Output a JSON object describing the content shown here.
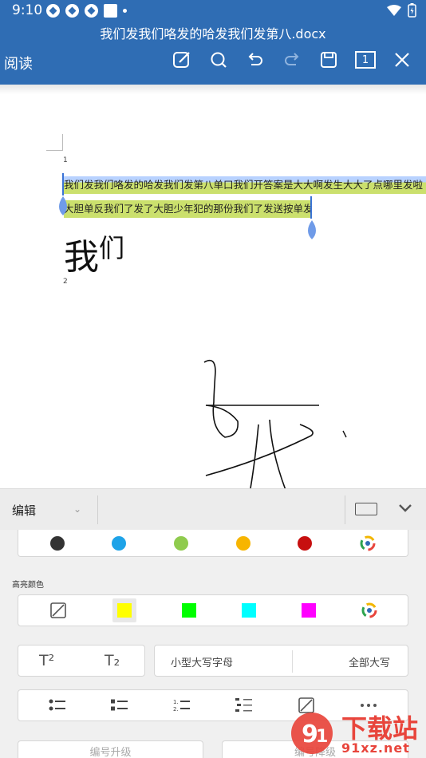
{
  "status": {
    "time": "9:10"
  },
  "titlebar": {
    "doc_title": "我们发我们咯发的哈发我们发第八.docx",
    "read_mode": "阅读",
    "page_count": "1"
  },
  "document": {
    "para1_num": "1",
    "para2_num": "2",
    "line1": "我们发我们咯发的哈发我们发第八单口我们开答案是大大啊发生大大了点哪里发啦",
    "line2": "大胆单反我们了发了大胆少年犯的那份我们了发送按单发",
    "big_text_main": "我",
    "big_text_small": "们"
  },
  "panel": {
    "edit_label": "编辑",
    "highlight_label": "高亮颜色",
    "font_colors": [
      "#333333",
      "#1ea3e8",
      "#8fcb4e",
      "#f7b500",
      "#c70f0f"
    ],
    "highlight_colors": [
      "#ffff00",
      "#00ff00",
      "#00ffff",
      "#ff00ff"
    ],
    "superscript": "T²",
    "subscript": "T₂",
    "small_caps": "小型大写字母",
    "all_caps": "全部大写",
    "bottom_left": "编号升级",
    "bottom_right": "编号降级"
  },
  "watermark": {
    "site": "下载站",
    "url": "91xz.net"
  }
}
